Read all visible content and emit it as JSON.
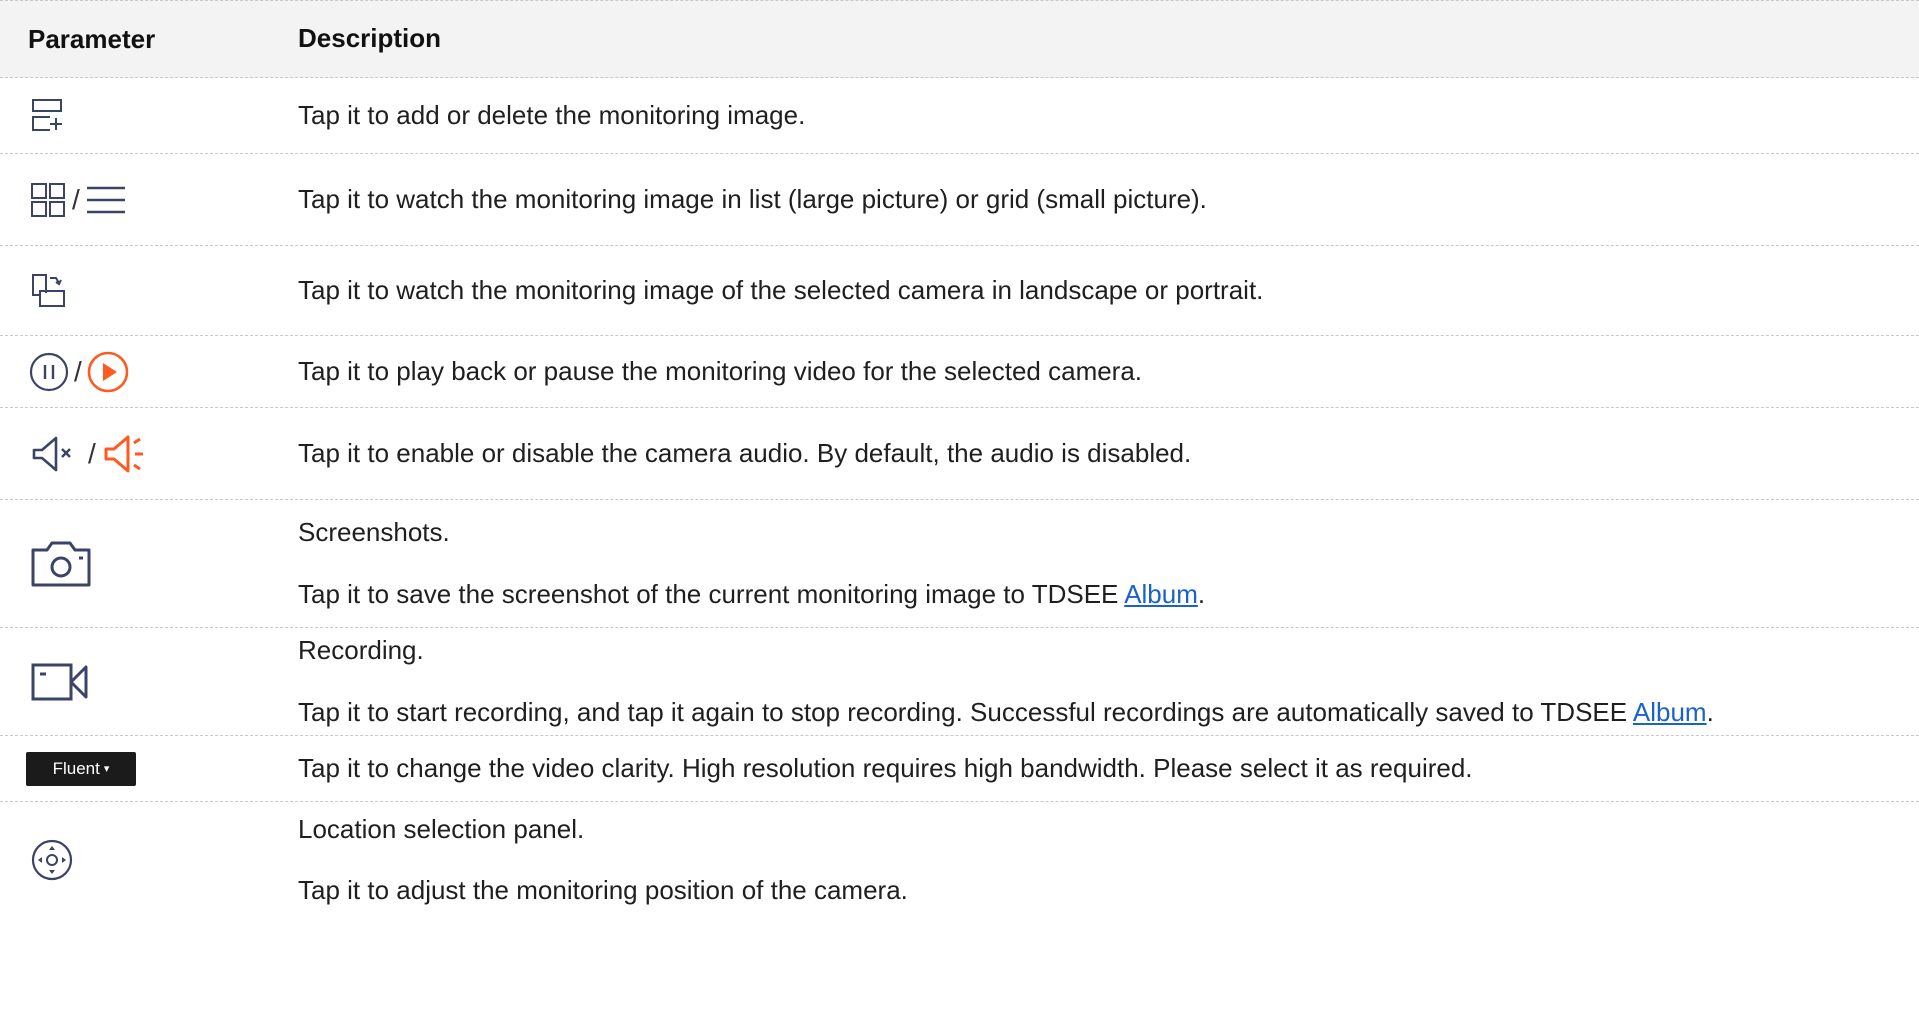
{
  "header": {
    "parameter": "Parameter",
    "description": "Description"
  },
  "colors": {
    "icon_navy": "#3b4367",
    "accent_orange": "#ff5a1f",
    "link_blue": "#1a62c9",
    "header_bg": "#f3f3f3"
  },
  "rows": [
    {
      "icons": [
        "add-delete-image-icon"
      ],
      "description": [
        "Tap it to add or delete the monitoring image."
      ]
    },
    {
      "icons": [
        "grid-view-icon",
        "list-view-icon"
      ],
      "separator": "/",
      "description": [
        "Tap it to watch the monitoring image in list (large picture) or grid (small picture)."
      ]
    },
    {
      "icons": [
        "rotate-screen-icon"
      ],
      "description": [
        "Tap it to watch the monitoring image of the selected camera in landscape or portrait."
      ]
    },
    {
      "icons": [
        "pause-icon",
        "play-icon"
      ],
      "separator": "/",
      "description": [
        "Tap it to play back or pause the monitoring video for the selected camera."
      ]
    },
    {
      "icons": [
        "mute-icon",
        "speaker-on-icon"
      ],
      "separator": "/",
      "description": [
        "Tap it to enable or disable the camera audio. By default, the audio is disabled."
      ]
    },
    {
      "icons": [
        "camera-icon"
      ],
      "description": [
        "Screenshots.",
        "Tap it to save the screenshot of the current monitoring image to TDSEE "
      ],
      "link": "Album",
      "after_link": "."
    },
    {
      "icons": [
        "video-record-icon"
      ],
      "description": [
        "Recording.",
        "Tap it to start recording, and tap it again to stop recording. Successful recordings are automatically saved to TDSEE "
      ],
      "link": "Album",
      "after_link": "."
    },
    {
      "icons": [
        "clarity-dropdown"
      ],
      "button_label": "Fluent",
      "button_caret": "▾",
      "description": [
        "Tap it to change the video clarity. High resolution requires high bandwidth. Please select it as required."
      ]
    },
    {
      "icons": [
        "ptz-control-icon"
      ],
      "description": [
        "Location selection panel.",
        "Tap it to adjust the monitoring position of the camera."
      ]
    }
  ]
}
